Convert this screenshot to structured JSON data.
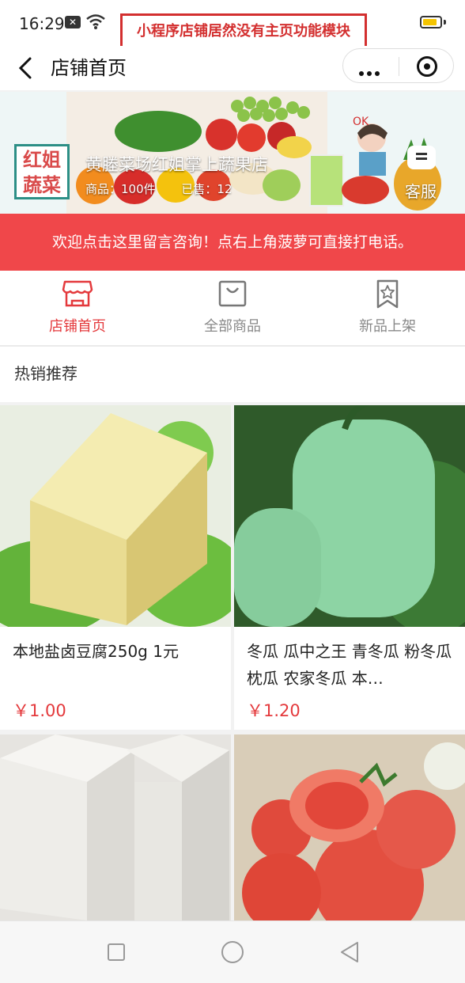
{
  "status_bar": {
    "time": "16:29"
  },
  "annotation": "小程序店铺居然没有主页功能模块",
  "nav": {
    "title": "店铺首页"
  },
  "store": {
    "logo_line1": "红姐",
    "logo_line2": "蔬菜",
    "name": "黄塍菜场红姐掌上蔬果店",
    "products_count": "商品：100件",
    "sold_count": "已售：12",
    "service_label": "客服",
    "banner_ok_text": "OK"
  },
  "notice": "欢迎点击这里留言咨询！点右上角菠萝可直接打电话。",
  "tabs": [
    {
      "label": "店铺首页",
      "icon": "storefront-icon",
      "active": true
    },
    {
      "label": "全部商品",
      "icon": "shopping-bag-icon",
      "active": false
    },
    {
      "label": "新品上架",
      "icon": "bookmark-star-icon",
      "active": false
    }
  ],
  "section_title": "热销推荐",
  "products": [
    {
      "title": "本地盐卤豆腐250g 1元",
      "price": "￥1.00",
      "image": "yellow-tofu-image"
    },
    {
      "title": "冬瓜 瓜中之王 青冬瓜 粉冬瓜 枕瓜 农家冬瓜 本…",
      "price": "￥1.20",
      "image": "winter-melon-image"
    },
    {
      "title": "",
      "price": "",
      "image": "white-tofu-image"
    },
    {
      "title": "",
      "price": "",
      "image": "tomato-image"
    }
  ],
  "colors": {
    "accent": "#e4393c",
    "notice_bg": "#f0474a",
    "logo_border": "#2c8f86",
    "annotation": "#d32f2f"
  }
}
